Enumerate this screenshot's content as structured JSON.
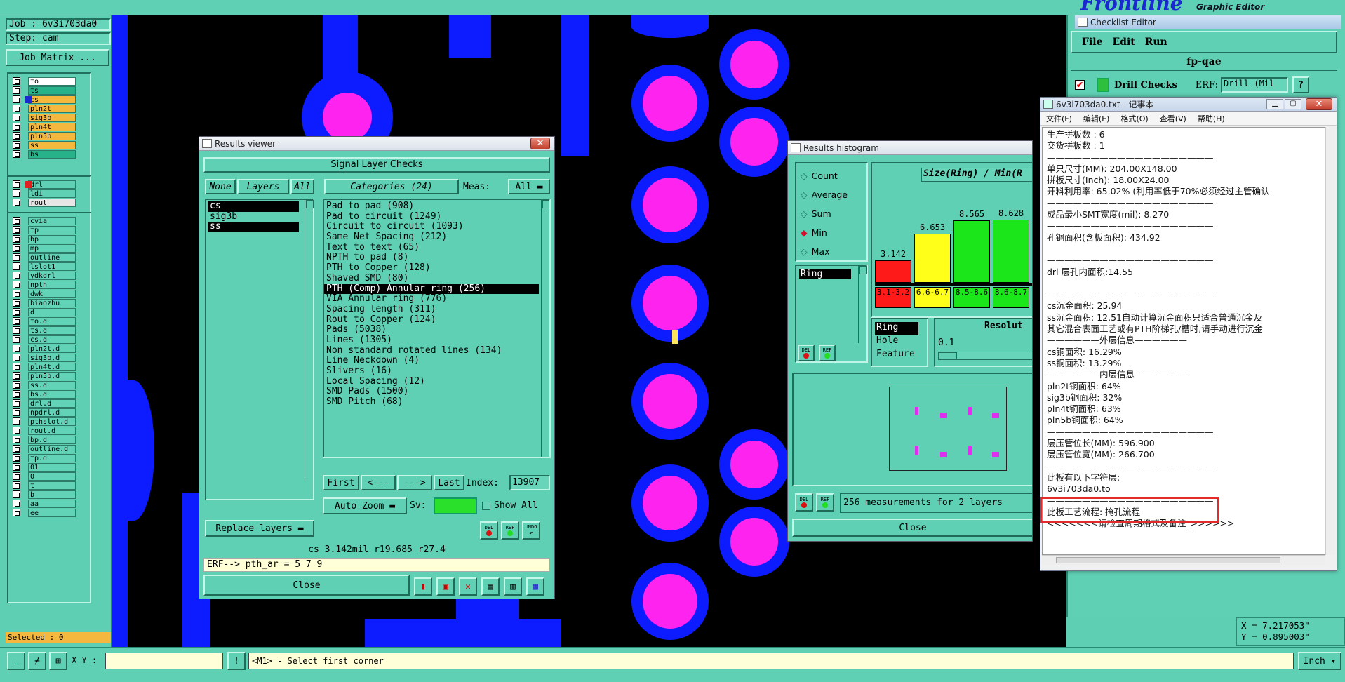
{
  "job": {
    "job_label": "Job : 6v3i703da0",
    "step_label": "Step: cam",
    "matrix_btn": "Job Matrix ..."
  },
  "layers1": [
    "to",
    "ts",
    "cs",
    "pln2t",
    "sig3b",
    "pln4t",
    "pln5b",
    "ss",
    "bs"
  ],
  "layers2": [
    "drl",
    "ldi",
    "rout"
  ],
  "layers3": [
    "cvia",
    "tp",
    "bp",
    "mp",
    "outline",
    "lslot1",
    "ydkdrl",
    "npth",
    "dwk",
    "biaozhu",
    "d",
    "to.d",
    "ts.d",
    "cs.d",
    "pln2t.d",
    "sig3b.d",
    "pln4t.d",
    "pln5b.d",
    "ss.d",
    "bs.d",
    "drl.d",
    "npdrl.d",
    "pthslot.d",
    "rout.d",
    "bp.d",
    "outline.d",
    "tp.d",
    "01",
    "0",
    "t",
    "b",
    "aa",
    "ee"
  ],
  "selected": "Selected : 0",
  "bottom": {
    "xy_label": "X Y :",
    "message": "<M1> - Select first corner",
    "unit": "Inch"
  },
  "coords": {
    "x": "X = 7.217053\"",
    "y": "Y = 0.895003\""
  },
  "top": {
    "brand": "Frontline",
    "subtitle": "Graphic Editor"
  },
  "results_viewer": {
    "title": "Results viewer",
    "header": "Signal Layer Checks",
    "none_btn": "None",
    "layers_btn": "Layers",
    "all_btn": "All",
    "categories_btn": "Categories (24)",
    "meas_label": "Meas:",
    "meas_value": "All",
    "layers": [
      "cs",
      "sig3b",
      "ss"
    ],
    "categories": [
      "Pad to pad (908)",
      "Pad to circuit (1249)",
      "Circuit to circuit (1093)",
      "Same Net Spacing (212)",
      "Text to text (65)",
      "NPTH to pad (8)",
      "PTH to Copper (128)",
      "Shaved SMD (80)",
      "PTH (Comp) Annular ring (256)",
      "VIA Annular ring (776)",
      "Spacing length (311)",
      "Rout to Copper (124)",
      "Pads (5038)",
      "Lines (1305)",
      "Non standard rotated lines (134)",
      "Line Neckdown (4)",
      "Slivers (16)",
      "Local Spacing (12)",
      "SMD Pads (1500)",
      "SMD Pitch (68)"
    ],
    "first": "First",
    "prev": "<---",
    "next": "--->",
    "last": "Last",
    "index_label": "Index:",
    "index_value": "13907",
    "autozoom": "Auto Zoom",
    "sv_label": "Sv:",
    "showall": "Show All",
    "replace": "Replace layers",
    "status": "cs 3.142mil  r19.685  r27.4",
    "erf": "ERF--> pth_ar = 5 7 9",
    "close": "Close",
    "del": "DEL",
    "ref": "REF",
    "undo": "UNDO"
  },
  "histogram": {
    "title": "Results histogram",
    "options": [
      "Count",
      "Average",
      "Sum",
      "Min",
      "Max"
    ],
    "graph_title": "Size(Ring) / Min(R",
    "list_item": "Ring",
    "bars": [
      {
        "value": "3.142",
        "range": "3.1-3.2",
        "color": "#ff1a1a",
        "h": 0.27
      },
      {
        "value": "6.653",
        "range": "6.6-6.7",
        "color": "#ffff1a",
        "h": 0.58
      },
      {
        "value": "8.565",
        "range": "8.5-8.6",
        "color": "#1ae61a",
        "h": 0.74
      },
      {
        "value": "8.628",
        "range": "8.6-8.7",
        "color": "#1ae61a",
        "h": 0.75
      }
    ],
    "sel_items": [
      "Ring",
      "Hole",
      "Feature"
    ],
    "resol_label": "Resolut",
    "resol_value": "0.1",
    "measurements": "256 measurements for 2 layers",
    "close": "Close",
    "del": "DEL",
    "ref": "REF"
  },
  "checklist": {
    "title": "Checklist Editor",
    "menu": [
      "File",
      "Edit",
      "Run"
    ],
    "name": "fp-qae",
    "row": "Drill Checks",
    "erf": "ERF:",
    "erf_value": "Drill (Mil",
    "help": "?"
  },
  "notepad": {
    "title": "6v3i703da0.txt - 记事本",
    "menu": [
      "文件(F)",
      "编辑(E)",
      "格式(O)",
      "查看(V)",
      "帮助(H)"
    ],
    "lines": [
      "生产拼板数 : 6",
      "交货拼板数 : 1",
      "———————————————————",
      "单只尺寸(MM): 204.00X148.00",
      "拼板尺寸(Inch): 18.00X24.00",
      "开料利用率: 65.02% (利用率低于70%必须经过主管确认",
      "———————————————————",
      "成品最小SMT宽度(mil): 8.270",
      "———————————————————",
      "孔铜面积(含板面积): 434.92",
      "",
      "———————————————————",
      "drl          层孔内面积:14.55",
      "",
      "———————————————————",
      "cs沉金面积: 25.94",
      "ss沉金面积: 12.51自动计算沉金面积只适合普通沉金及",
      "其它混合表面工艺或有PTH阶梯孔/槽时,请手动进行沉金",
      "——————外层信息——————",
      "cs铜面积: 16.29%",
      "ss铜面积: 13.29%",
      "——————内层信息——————",
      "pln2t铜面积: 64%",
      "sig3b铜面积: 32%",
      "pln4t铜面积: 63%",
      "pln5b铜面积: 64%",
      "———————————————————",
      "层压管位长(MM): 596.900",
      "层压管位宽(MM): 266.700",
      "———————————————————",
      "此板有以下字符层:",
      "6v3i703da0.to",
      "———————————————————",
      "此板工艺流程: 掩孔流程",
      "<<<<<<<请检查周期格式及备注_>>>>>>"
    ]
  }
}
